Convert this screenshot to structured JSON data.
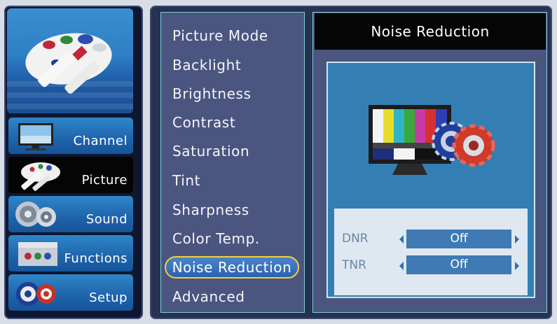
{
  "categories": [
    {
      "label": "Channel",
      "icon": "tv-icon",
      "selected": false
    },
    {
      "label": "Picture",
      "icon": "palette-icon",
      "selected": true
    },
    {
      "label": "Sound",
      "icon": "speaker-icon",
      "selected": false
    },
    {
      "label": "Functions",
      "icon": "toolbox-icon",
      "selected": false
    },
    {
      "label": "Setup",
      "icon": "gears-icon",
      "selected": false
    }
  ],
  "banner": {
    "icon": "palette-icon"
  },
  "menu": {
    "items": [
      "Picture Mode",
      "Backlight",
      "Brightness",
      "Contrast",
      "Saturation",
      "Tint",
      "Sharpness",
      "Color Temp.",
      "Noise Reduction",
      "Advanced"
    ],
    "selected": "Noise Reduction"
  },
  "detail": {
    "title": "Noise Reduction",
    "illustration": "monitor-with-gears-icon",
    "settings": [
      {
        "label": "DNR",
        "value": "Off"
      },
      {
        "label": "TNR",
        "value": "Off"
      }
    ]
  },
  "colors": {
    "highlight_border": "#f0d23a",
    "panel_bg": "#4a5580",
    "accent_blue": "#337fb4"
  }
}
